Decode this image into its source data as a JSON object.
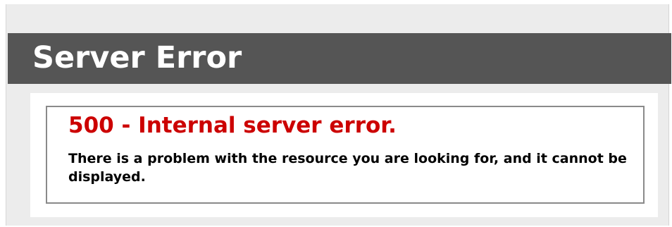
{
  "header": {
    "title": "Server Error"
  },
  "error": {
    "title": "500 - Internal server error.",
    "message": "There is a problem with the resource you are looking for, and it cannot be displayed."
  },
  "colors": {
    "header_background": "#555555",
    "error_title": "#cc0000",
    "page_background": "#ececec"
  }
}
